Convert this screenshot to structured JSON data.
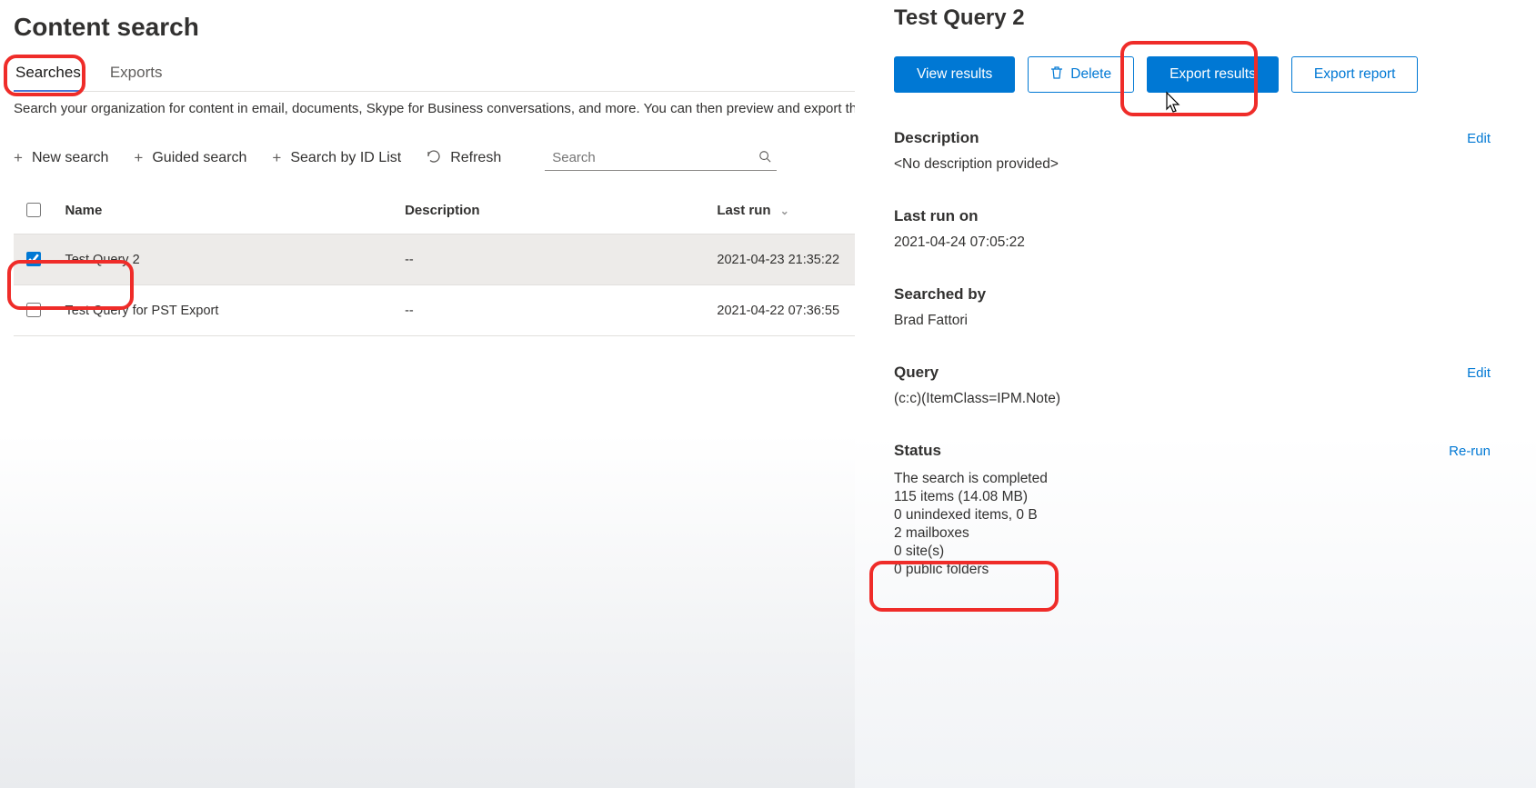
{
  "page": {
    "title": "Content search",
    "intro": "Search your organization for content in email, documents, Skype for Business conversations, and more. You can then preview and export the sear"
  },
  "tabs": {
    "searches": "Searches",
    "exports": "Exports"
  },
  "toolbar": {
    "new_search": "New search",
    "guided_search": "Guided search",
    "search_by_id": "Search by ID List",
    "refresh": "Refresh",
    "search_placeholder": "Search"
  },
  "grid": {
    "headers": {
      "name": "Name",
      "description": "Description",
      "last_run": "Last run"
    },
    "rows": [
      {
        "checked": true,
        "name": "Test Query 2",
        "description": "--",
        "last_run": "2021-04-23 21:35:22"
      },
      {
        "checked": false,
        "name": "Test Query for PST Export",
        "description": "--",
        "last_run": "2021-04-22 07:36:55"
      }
    ]
  },
  "detail": {
    "title": "Test Query 2",
    "actions": {
      "view_results": "View results",
      "delete": "Delete",
      "export_results": "Export results",
      "export_report": "Export report"
    },
    "description_label": "Description",
    "description_value": "<No description provided>",
    "edit_link": "Edit",
    "last_run_label": "Last run on",
    "last_run_value": "2021-04-24 07:05:22",
    "searched_by_label": "Searched by",
    "searched_by_value": "Brad Fattori",
    "query_label": "Query",
    "query_value": "(c:c)(ItemClass=IPM.Note)",
    "status_label": "Status",
    "status_rerun": "Re-run",
    "status_lines": {
      "l1": "The search is completed",
      "l2": "115 items (14.08 MB)",
      "l3": "0 unindexed items, 0 B",
      "l4": "2 mailboxes",
      "l5": "0 site(s)",
      "l6": "0 public folders"
    }
  }
}
